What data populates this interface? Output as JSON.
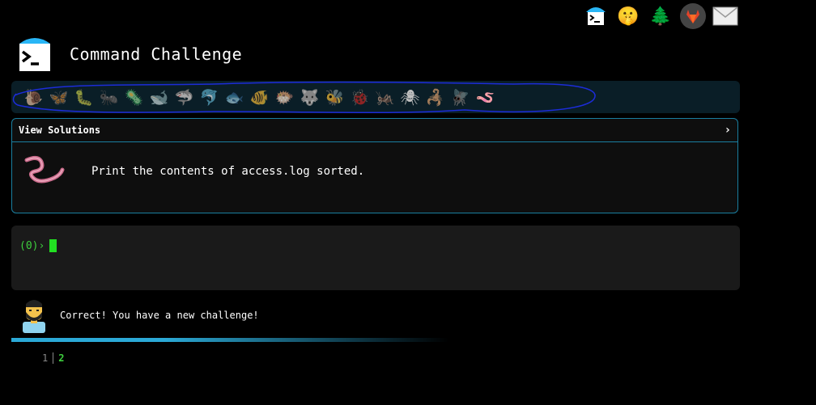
{
  "header": {
    "title": "Command Challenge"
  },
  "top_icons": [
    {
      "name": "terminal-logo-icon"
    },
    {
      "name": "shushing-face-icon",
      "glyph": "🤫"
    },
    {
      "name": "tree-icon",
      "glyph": "🌲"
    },
    {
      "name": "gitlab-icon"
    },
    {
      "name": "mail-icon",
      "glyph": "✉"
    }
  ],
  "animals": [
    "🐌",
    "🦋",
    "🐛",
    "🐜",
    "🦠",
    "🐋",
    "🦈",
    "🐬",
    "🐟",
    "🐠",
    "🐡",
    "🐺",
    "🐝",
    "🐞",
    "🦗",
    "🕷",
    "🦂",
    "🪰",
    "🪱"
  ],
  "challenge": {
    "header_label": "View Solutions",
    "chevron": "›",
    "text": "Print the contents of access.log sorted."
  },
  "terminal": {
    "prompt": "(0)›"
  },
  "message": {
    "text": "Correct! You have a new challenge!"
  },
  "pager": {
    "pages": [
      "1",
      "2"
    ],
    "current": "2"
  },
  "colors": {
    "accent": "#1a7fa0",
    "prompt_green": "#3ecf3e",
    "panel": "#1a1a1a"
  }
}
